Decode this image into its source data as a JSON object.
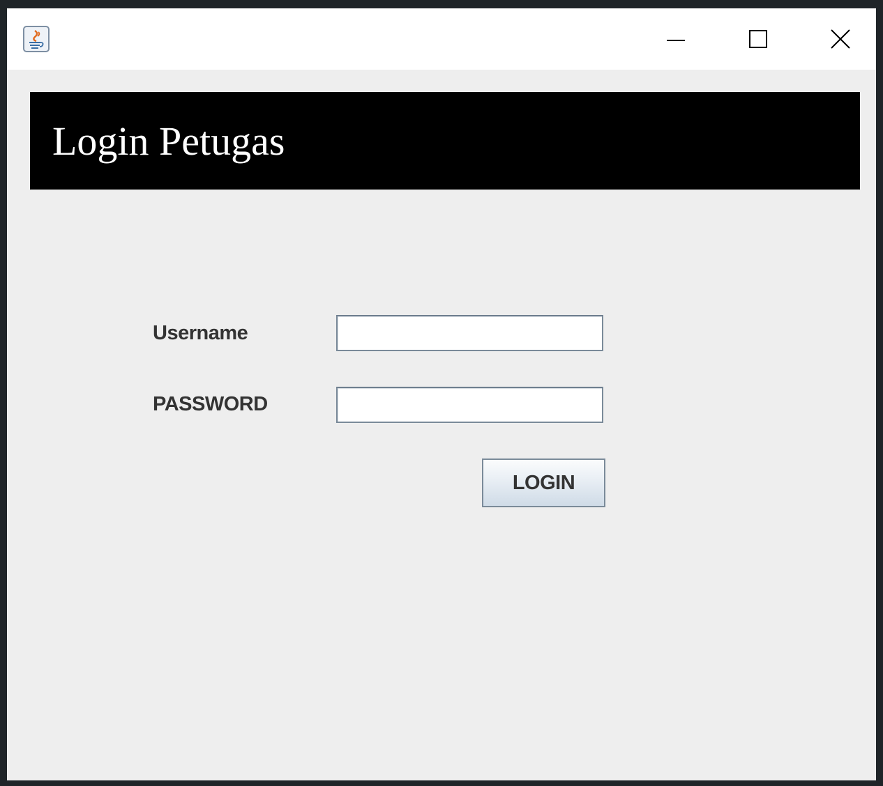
{
  "window": {
    "title": "",
    "controls": {
      "minimize_icon": "minimize-icon",
      "maximize_icon": "maximize-icon",
      "close_icon": "close-icon"
    },
    "app_icon": "java-coffee-icon"
  },
  "header": {
    "title": "Login Petugas",
    "background": "#000000",
    "text_color": "#ffffff"
  },
  "form": {
    "username_label": "Username",
    "username_value": "",
    "password_label": "PASSWORD",
    "password_value": "",
    "login_label": "LOGIN"
  },
  "colors": {
    "panel_background": "#eeeeee",
    "button_gradient_bottom": "#cfdbe7"
  }
}
